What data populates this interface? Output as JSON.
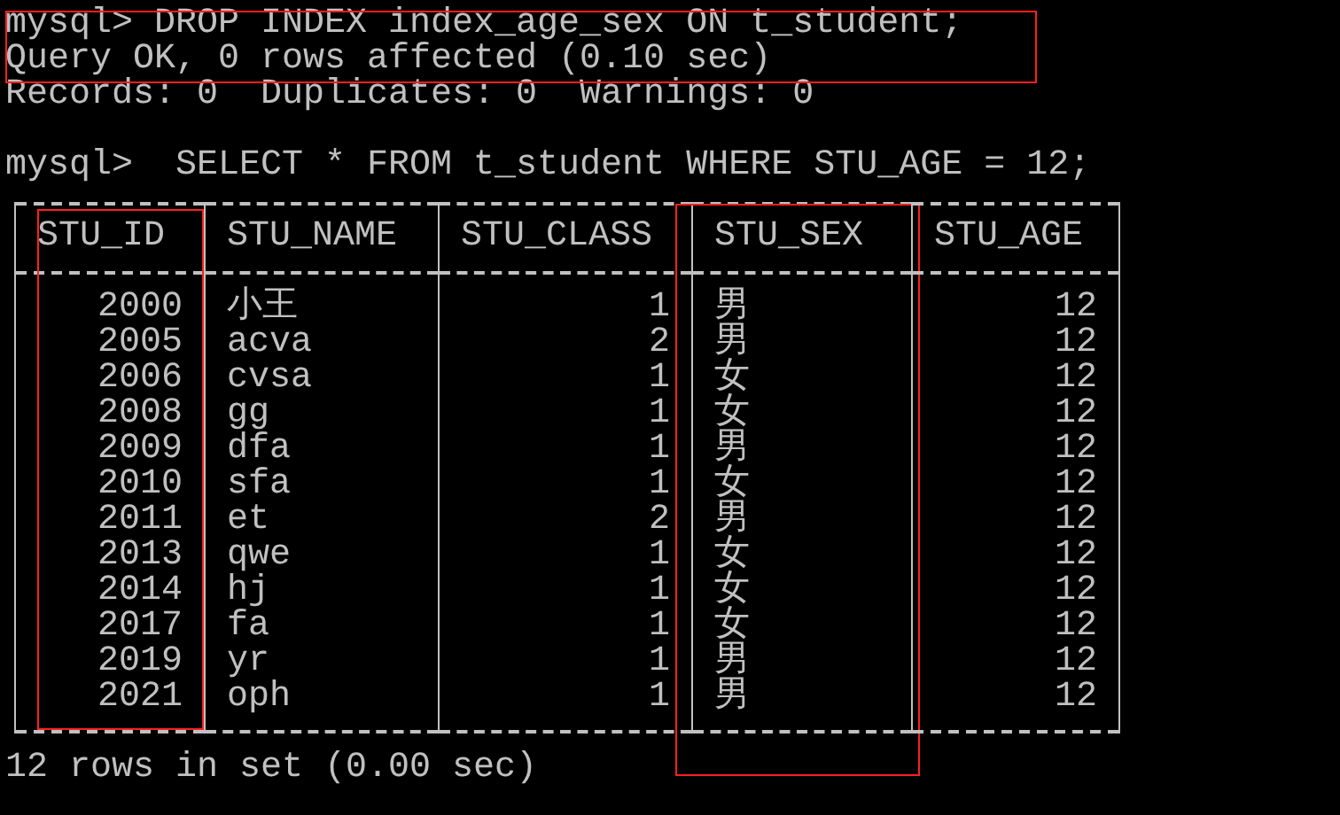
{
  "command_block": {
    "highlighted": true,
    "lines": [
      "mysql> DROP INDEX index_age_sex ON t_student;",
      "Query OK, 0 rows affected (0.10 sec)"
    ]
  },
  "output_lines": [
    "Records: 0  Duplicates: 0  Warnings: 0"
  ],
  "prompt": "mysql>  SELECT * FROM t_student WHERE STU_AGE = 12;",
  "table": {
    "columns": [
      {
        "label": "STU_ID",
        "kind": "number",
        "highlighted": true
      },
      {
        "label": "STU_NAME",
        "kind": "text",
        "highlighted": false
      },
      {
        "label": "STU_CLASS",
        "kind": "number",
        "highlighted": false
      },
      {
        "label": "STU_SEX",
        "kind": "text",
        "highlighted": true
      },
      {
        "label": "STU_AGE",
        "kind": "number",
        "highlighted": false
      }
    ],
    "rows": [
      [
        "2000",
        "小王",
        "1",
        "男",
        "12"
      ],
      [
        "2005",
        "acva",
        "2",
        "男",
        "12"
      ],
      [
        "2006",
        "cvsa",
        "1",
        "女",
        "12"
      ],
      [
        "2008",
        "gg",
        "1",
        "女",
        "12"
      ],
      [
        "2009",
        "dfa",
        "1",
        "男",
        "12"
      ],
      [
        "2010",
        "sfa",
        "1",
        "女",
        "12"
      ],
      [
        "2011",
        "et",
        "2",
        "男",
        "12"
      ],
      [
        "2013",
        "qwe",
        "1",
        "女",
        "12"
      ],
      [
        "2014",
        "hj",
        "1",
        "女",
        "12"
      ],
      [
        "2017",
        "fa",
        "1",
        "女",
        "12"
      ],
      [
        "2019",
        "yr",
        "1",
        "男",
        "12"
      ],
      [
        "2021",
        "oph",
        "1",
        "男",
        "12"
      ]
    ]
  },
  "footer": "12 rows in set (0.00 sec)"
}
